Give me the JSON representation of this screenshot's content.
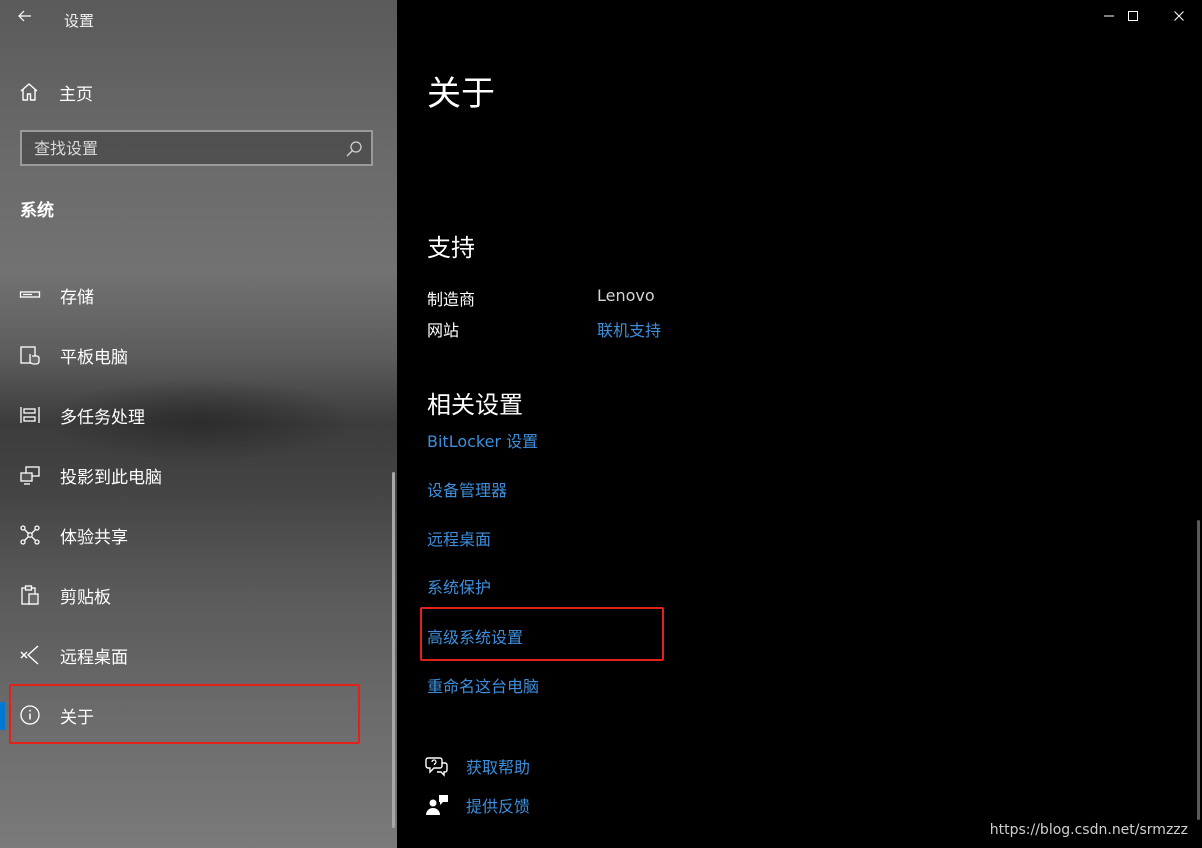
{
  "window": {
    "title": "设置",
    "controls": [
      "minimize",
      "maximize",
      "close"
    ]
  },
  "sidebar": {
    "home_label": "主页",
    "search": {
      "placeholder": "查找设置"
    },
    "section": "系统",
    "items": [
      {
        "label": "存储",
        "icon": "storage-icon"
      },
      {
        "label": "平板电脑",
        "icon": "tablet-icon"
      },
      {
        "label": "多任务处理",
        "icon": "multitasking-icon"
      },
      {
        "label": "投影到此电脑",
        "icon": "project-icon"
      },
      {
        "label": "体验共享",
        "icon": "share-icon"
      },
      {
        "label": "剪贴板",
        "icon": "clipboard-icon"
      },
      {
        "label": "远程桌面",
        "icon": "remote-desktop-icon"
      },
      {
        "label": "关于",
        "icon": "info-icon",
        "selected": true
      }
    ]
  },
  "main": {
    "title": "关于",
    "support": {
      "heading": "支持",
      "manufacturer_label": "制造商",
      "manufacturer_value": "Lenovo",
      "website_label": "网站",
      "website_value": "联机支持"
    },
    "related": {
      "heading": "相关设置",
      "links": [
        "BitLocker 设置",
        "设备管理器",
        "远程桌面",
        "系统保护",
        "高级系统设置",
        "重命名这台电脑"
      ]
    },
    "help": {
      "get_help": "获取帮助",
      "feedback": "提供反馈"
    }
  },
  "watermark": "https://blog.csdn.net/srmzzz",
  "colors": {
    "accent": "#0078d4",
    "link": "#3d8fdd",
    "highlight": "#e3211b"
  }
}
